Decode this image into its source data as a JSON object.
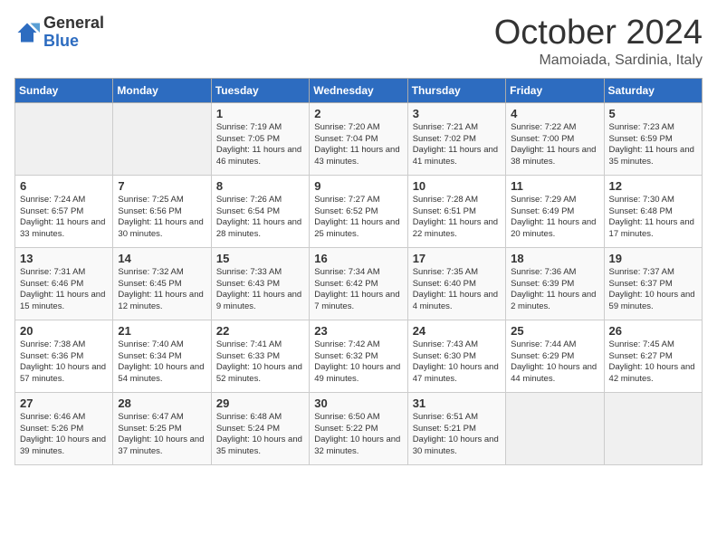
{
  "logo": {
    "general": "General",
    "blue": "Blue"
  },
  "title": "October 2024",
  "location": "Mamoiada, Sardinia, Italy",
  "days": [
    "Sunday",
    "Monday",
    "Tuesday",
    "Wednesday",
    "Thursday",
    "Friday",
    "Saturday"
  ],
  "weeks": [
    [
      {
        "day": "",
        "sunrise": "",
        "sunset": "",
        "daylight": ""
      },
      {
        "day": "",
        "sunrise": "",
        "sunset": "",
        "daylight": ""
      },
      {
        "day": "1",
        "sunrise": "Sunrise: 7:19 AM",
        "sunset": "Sunset: 7:05 PM",
        "daylight": "Daylight: 11 hours and 46 minutes."
      },
      {
        "day": "2",
        "sunrise": "Sunrise: 7:20 AM",
        "sunset": "Sunset: 7:04 PM",
        "daylight": "Daylight: 11 hours and 43 minutes."
      },
      {
        "day": "3",
        "sunrise": "Sunrise: 7:21 AM",
        "sunset": "Sunset: 7:02 PM",
        "daylight": "Daylight: 11 hours and 41 minutes."
      },
      {
        "day": "4",
        "sunrise": "Sunrise: 7:22 AM",
        "sunset": "Sunset: 7:00 PM",
        "daylight": "Daylight: 11 hours and 38 minutes."
      },
      {
        "day": "5",
        "sunrise": "Sunrise: 7:23 AM",
        "sunset": "Sunset: 6:59 PM",
        "daylight": "Daylight: 11 hours and 35 minutes."
      }
    ],
    [
      {
        "day": "6",
        "sunrise": "Sunrise: 7:24 AM",
        "sunset": "Sunset: 6:57 PM",
        "daylight": "Daylight: 11 hours and 33 minutes."
      },
      {
        "day": "7",
        "sunrise": "Sunrise: 7:25 AM",
        "sunset": "Sunset: 6:56 PM",
        "daylight": "Daylight: 11 hours and 30 minutes."
      },
      {
        "day": "8",
        "sunrise": "Sunrise: 7:26 AM",
        "sunset": "Sunset: 6:54 PM",
        "daylight": "Daylight: 11 hours and 28 minutes."
      },
      {
        "day": "9",
        "sunrise": "Sunrise: 7:27 AM",
        "sunset": "Sunset: 6:52 PM",
        "daylight": "Daylight: 11 hours and 25 minutes."
      },
      {
        "day": "10",
        "sunrise": "Sunrise: 7:28 AM",
        "sunset": "Sunset: 6:51 PM",
        "daylight": "Daylight: 11 hours and 22 minutes."
      },
      {
        "day": "11",
        "sunrise": "Sunrise: 7:29 AM",
        "sunset": "Sunset: 6:49 PM",
        "daylight": "Daylight: 11 hours and 20 minutes."
      },
      {
        "day": "12",
        "sunrise": "Sunrise: 7:30 AM",
        "sunset": "Sunset: 6:48 PM",
        "daylight": "Daylight: 11 hours and 17 minutes."
      }
    ],
    [
      {
        "day": "13",
        "sunrise": "Sunrise: 7:31 AM",
        "sunset": "Sunset: 6:46 PM",
        "daylight": "Daylight: 11 hours and 15 minutes."
      },
      {
        "day": "14",
        "sunrise": "Sunrise: 7:32 AM",
        "sunset": "Sunset: 6:45 PM",
        "daylight": "Daylight: 11 hours and 12 minutes."
      },
      {
        "day": "15",
        "sunrise": "Sunrise: 7:33 AM",
        "sunset": "Sunset: 6:43 PM",
        "daylight": "Daylight: 11 hours and 9 minutes."
      },
      {
        "day": "16",
        "sunrise": "Sunrise: 7:34 AM",
        "sunset": "Sunset: 6:42 PM",
        "daylight": "Daylight: 11 hours and 7 minutes."
      },
      {
        "day": "17",
        "sunrise": "Sunrise: 7:35 AM",
        "sunset": "Sunset: 6:40 PM",
        "daylight": "Daylight: 11 hours and 4 minutes."
      },
      {
        "day": "18",
        "sunrise": "Sunrise: 7:36 AM",
        "sunset": "Sunset: 6:39 PM",
        "daylight": "Daylight: 11 hours and 2 minutes."
      },
      {
        "day": "19",
        "sunrise": "Sunrise: 7:37 AM",
        "sunset": "Sunset: 6:37 PM",
        "daylight": "Daylight: 10 hours and 59 minutes."
      }
    ],
    [
      {
        "day": "20",
        "sunrise": "Sunrise: 7:38 AM",
        "sunset": "Sunset: 6:36 PM",
        "daylight": "Daylight: 10 hours and 57 minutes."
      },
      {
        "day": "21",
        "sunrise": "Sunrise: 7:40 AM",
        "sunset": "Sunset: 6:34 PM",
        "daylight": "Daylight: 10 hours and 54 minutes."
      },
      {
        "day": "22",
        "sunrise": "Sunrise: 7:41 AM",
        "sunset": "Sunset: 6:33 PM",
        "daylight": "Daylight: 10 hours and 52 minutes."
      },
      {
        "day": "23",
        "sunrise": "Sunrise: 7:42 AM",
        "sunset": "Sunset: 6:32 PM",
        "daylight": "Daylight: 10 hours and 49 minutes."
      },
      {
        "day": "24",
        "sunrise": "Sunrise: 7:43 AM",
        "sunset": "Sunset: 6:30 PM",
        "daylight": "Daylight: 10 hours and 47 minutes."
      },
      {
        "day": "25",
        "sunrise": "Sunrise: 7:44 AM",
        "sunset": "Sunset: 6:29 PM",
        "daylight": "Daylight: 10 hours and 44 minutes."
      },
      {
        "day": "26",
        "sunrise": "Sunrise: 7:45 AM",
        "sunset": "Sunset: 6:27 PM",
        "daylight": "Daylight: 10 hours and 42 minutes."
      }
    ],
    [
      {
        "day": "27",
        "sunrise": "Sunrise: 6:46 AM",
        "sunset": "Sunset: 5:26 PM",
        "daylight": "Daylight: 10 hours and 39 minutes."
      },
      {
        "day": "28",
        "sunrise": "Sunrise: 6:47 AM",
        "sunset": "Sunset: 5:25 PM",
        "daylight": "Daylight: 10 hours and 37 minutes."
      },
      {
        "day": "29",
        "sunrise": "Sunrise: 6:48 AM",
        "sunset": "Sunset: 5:24 PM",
        "daylight": "Daylight: 10 hours and 35 minutes."
      },
      {
        "day": "30",
        "sunrise": "Sunrise: 6:50 AM",
        "sunset": "Sunset: 5:22 PM",
        "daylight": "Daylight: 10 hours and 32 minutes."
      },
      {
        "day": "31",
        "sunrise": "Sunrise: 6:51 AM",
        "sunset": "Sunset: 5:21 PM",
        "daylight": "Daylight: 10 hours and 30 minutes."
      },
      {
        "day": "",
        "sunrise": "",
        "sunset": "",
        "daylight": ""
      },
      {
        "day": "",
        "sunrise": "",
        "sunset": "",
        "daylight": ""
      }
    ]
  ]
}
